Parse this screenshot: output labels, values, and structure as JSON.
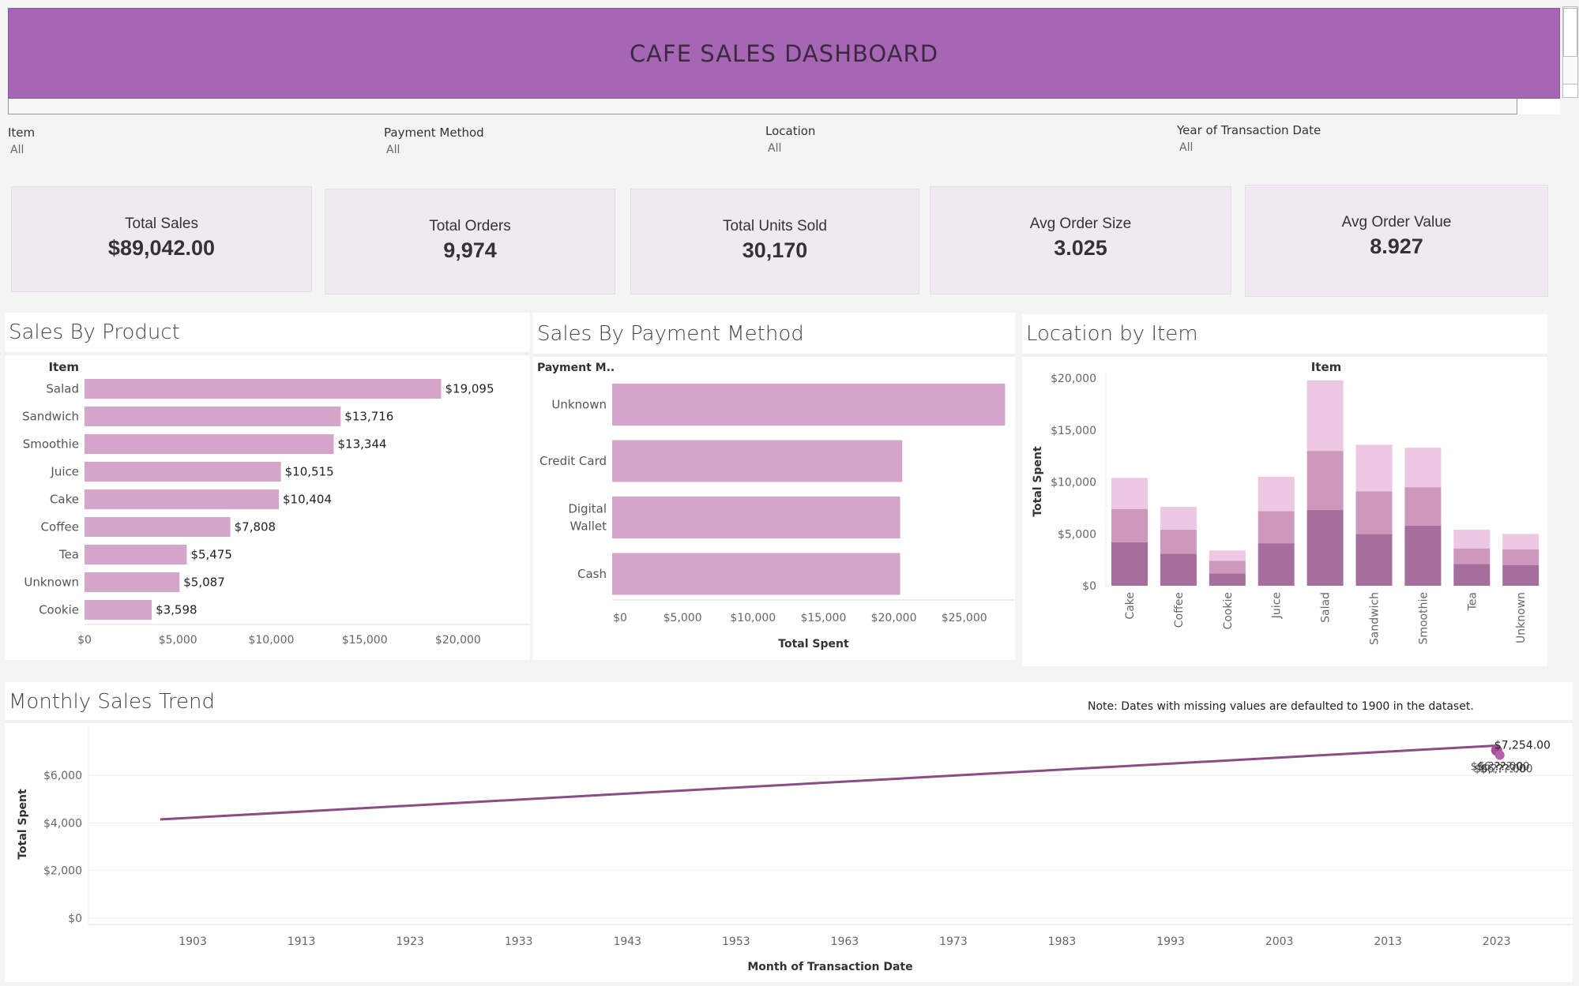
{
  "header": {
    "title": "CAFE SALES DASHBOARD"
  },
  "filters": [
    {
      "label": "Item",
      "value": "All"
    },
    {
      "label": "Payment Method",
      "value": "All"
    },
    {
      "label": "Location",
      "value": "All"
    },
    {
      "label": "Year of Transaction Date",
      "value": "All"
    }
  ],
  "kpis": [
    {
      "label": "Total Sales",
      "value": "$89,042.00"
    },
    {
      "label": "Total Orders",
      "value": "9,974"
    },
    {
      "label": "Total Units Sold",
      "value": "30,170"
    },
    {
      "label": "Avg Order Size",
      "value": "3.025"
    },
    {
      "label": "Avg Order Value",
      "value": "8.927"
    }
  ],
  "colors": {
    "header": "#a666b4",
    "bar": "#d4a5c9",
    "stack_dark": "#a66e9c",
    "stack_mid": "#cd98bc",
    "stack_light": "#ecc8e2",
    "line": "#8a4d84"
  },
  "panels": {
    "product": {
      "title": "Sales By Product"
    },
    "payment": {
      "title": "Sales By Payment Method"
    },
    "location": {
      "title": "Location by Item"
    },
    "trend": {
      "title": "Monthly Sales Trend",
      "note": "Note: Dates with missing values are defaulted to 1900 in the dataset."
    }
  },
  "chart_data": [
    {
      "type": "bar",
      "orientation": "horizontal",
      "title": "Sales By Product",
      "row_header": "Item",
      "categories": [
        "Salad",
        "Sandwich",
        "Smoothie",
        "Juice",
        "Cake",
        "Coffee",
        "Tea",
        "Unknown",
        "Cookie"
      ],
      "values": [
        19095,
        13716,
        13344,
        10515,
        10404,
        7808,
        5475,
        5087,
        3598
      ],
      "data_labels": [
        "$19,095",
        "$13,716",
        "$13,344",
        "$10,515",
        "$10,404",
        "$7,808",
        "$5,475",
        "$5,087",
        "$3,598"
      ],
      "x_ticks": [
        "$0",
        "$5,000",
        "$10,000",
        "$15,000",
        "$20,000"
      ],
      "x_tick_values": [
        0,
        5000,
        10000,
        15000,
        20000
      ],
      "xlim": [
        0,
        22500
      ]
    },
    {
      "type": "bar",
      "orientation": "horizontal",
      "title": "Sales By Payment Method",
      "row_header": "Payment M..",
      "categories": [
        "Unknown",
        "Credit Card",
        "Digital Wallet",
        "Cash"
      ],
      "category_lines": [
        [
          "Unknown"
        ],
        [
          "Credit Card"
        ],
        [
          "Digital",
          "Wallet"
        ],
        [
          "Cash"
        ]
      ],
      "values": [
        27900,
        20600,
        20450,
        20450
      ],
      "xlabel": "Total Spent",
      "x_ticks": [
        "$0",
        "$5,000",
        "$10,000",
        "$15,000",
        "$20,000",
        "$25,000"
      ],
      "x_tick_values": [
        0,
        5000,
        10000,
        15000,
        20000,
        25000
      ],
      "xlim": [
        0,
        29000
      ]
    },
    {
      "type": "bar",
      "stacked": true,
      "title": "Location by Item",
      "column_header": "Item",
      "ylabel": "Total Spent",
      "categories": [
        "Cake",
        "Coffee",
        "Cookie",
        "Juice",
        "Salad",
        "Sandwich",
        "Smoothie",
        "Tea",
        "Unknown"
      ],
      "series": [
        {
          "values": [
            4200,
            3100,
            1200,
            4100,
            7300,
            5000,
            5800,
            2100,
            2000
          ]
        },
        {
          "values": [
            3200,
            2300,
            1200,
            3100,
            5700,
            4100,
            3700,
            1500,
            1500
          ]
        },
        {
          "values": [
            3000,
            2200,
            1000,
            3300,
            6800,
            4500,
            3800,
            1800,
            1500
          ]
        }
      ],
      "y_ticks": [
        "$0",
        "$5,000",
        "$10,000",
        "$15,000",
        "$20,000"
      ],
      "y_tick_values": [
        0,
        5000,
        10000,
        15000,
        20000
      ],
      "ylim": [
        0,
        21000
      ]
    },
    {
      "type": "line",
      "title": "Monthly Sales Trend",
      "xlabel": "Month of Transaction Date",
      "ylabel": "Total Spent",
      "x": [
        1900,
        2023
      ],
      "y": [
        4150,
        7254
      ],
      "endpoint_label": "$7,254.00",
      "cluster_label": "$6,???.00",
      "x_ticks": [
        "1903",
        "1913",
        "1923",
        "1933",
        "1943",
        "1953",
        "1963",
        "1973",
        "1983",
        "1993",
        "2003",
        "2013",
        "2023"
      ],
      "x_tick_values": [
        1903,
        1913,
        1923,
        1933,
        1943,
        1953,
        1963,
        1973,
        1983,
        1993,
        2003,
        2013,
        2023
      ],
      "y_ticks": [
        "$0",
        "$2,000",
        "$4,000",
        "$6,000"
      ],
      "y_tick_values": [
        0,
        2000,
        4000,
        6000
      ],
      "xlim": [
        1893.4,
        2030
      ],
      "ylim": [
        0,
        7800
      ]
    }
  ]
}
